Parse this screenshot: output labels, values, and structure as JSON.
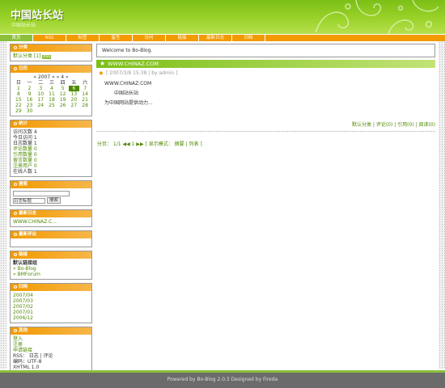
{
  "header": {
    "title": "中国站长站",
    "subtitle": "中国站长站"
  },
  "nav": [
    "首页",
    "RSS",
    "标签",
    "留言",
    "访问",
    "链接",
    "最新日志",
    "归档"
  ],
  "sidebar": {
    "categories": {
      "title": "分类",
      "item": "默认分类 [1]",
      "tag": "RSS"
    },
    "calendar": {
      "title": "日历",
      "header": "« 2007 »    « 4 »",
      "weekdays": [
        "日",
        "一",
        "二",
        "三",
        "四",
        "五",
        "六"
      ],
      "weeks": [
        [
          "1",
          "2",
          "3",
          "4",
          "5",
          "6",
          "7"
        ],
        [
          "8",
          "9",
          "10",
          "11",
          "12",
          "13",
          "14"
        ],
        [
          "15",
          "16",
          "17",
          "18",
          "19",
          "20",
          "21"
        ],
        [
          "22",
          "23",
          "24",
          "25",
          "26",
          "27",
          "28"
        ],
        [
          "29",
          "30",
          "",
          "",
          "",
          "",
          ""
        ]
      ]
    },
    "stats": {
      "title": "统计",
      "lines": [
        "访问次数 4",
        "今日访问 1",
        "日志数量 1",
        "评论数量 0",
        "引用数量 0",
        "留言数量 0",
        "注册用户 0",
        "在线人数 1"
      ]
    },
    "search": {
      "title": "搜索",
      "select": "日志标题",
      "button": "搜索"
    },
    "recent_posts": {
      "title": "最新日志",
      "item": "WWW.CHINAZ.C..."
    },
    "recent_comments": {
      "title": "最新评论"
    },
    "links": {
      "title": "链接",
      "group": "默认链接组",
      "items": [
        "» Bo-Blog",
        "» BMForum"
      ]
    },
    "archives": {
      "title": "归档",
      "items": [
        "2007/04",
        "2007/03",
        "2007/02",
        "2007/01",
        "2006/12"
      ]
    },
    "misc": {
      "title": "其他",
      "lines": [
        "登入",
        "注册",
        "申请链接",
        "RSS： 日志 | 评论",
        "编码：UTF-8",
        "XHTML 1.0"
      ]
    }
  },
  "main": {
    "welcome": "Welcome to Bo-Blog.",
    "post": {
      "title": "WWW.CHINAZ.COM",
      "meta": "[ 2007/3/8 15:38 | by admin ]",
      "body": [
        "WWW.CHINAZ.COM",
        "中国站长站",
        "为中国网站提供动力..."
      ],
      "footer": "默认分类 | 评论(0) | 引用(0) | 阅读(0)"
    },
    "pager": "分页： 1/1  ◀◀ 1 ▶▶  [ 显示模式： 摘要 | 列表 ]"
  },
  "footer": {
    "text": "Powered by Bo-Blog 2.0.3 Designed by Fireda"
  },
  "colors": {
    "green": "#8cc03c",
    "orange": "#f29a00",
    "dark_green": "#4f8a00",
    "footer_gray": "#6b6b6b"
  }
}
